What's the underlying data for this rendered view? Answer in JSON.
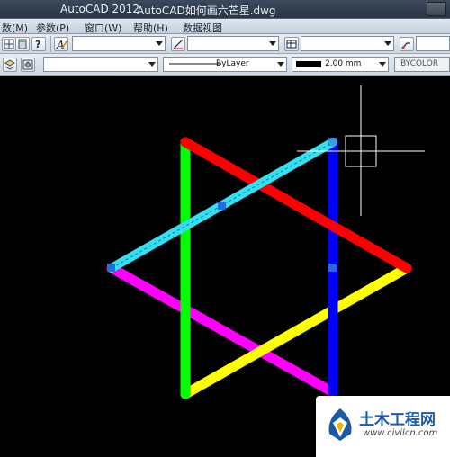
{
  "window": {
    "app_title": "AutoCAD 2012",
    "file_title": "AutoCAD如何画六芒星.dwg"
  },
  "menu": [
    {
      "label": "数(M)"
    },
    {
      "label": "参数(P)"
    },
    {
      "label": "窗口(W)"
    },
    {
      "label": "帮助(H)"
    },
    {
      "label": "数据视图"
    }
  ],
  "properties": {
    "linetype": "ByLayer",
    "lineweight": "2.00 mm",
    "plotstyle": "BYCOLOR"
  },
  "watermark": {
    "name": "土木工程网",
    "url": "www.civilcn.com"
  },
  "colors": {
    "red": "#ff0000",
    "green": "#00ff00",
    "blue": "#0000ff",
    "cyan": "#33e0f0",
    "magenta": "#ff00ff",
    "yellow": "#ffff00",
    "grip": "#1e6fd9"
  },
  "icons": [
    "grid-icon",
    "help-icon",
    "text-style-icon",
    "dimension-style-icon",
    "table-style-icon",
    "multileader-style-icon",
    "layer-icon",
    "layer-state-icon"
  ]
}
